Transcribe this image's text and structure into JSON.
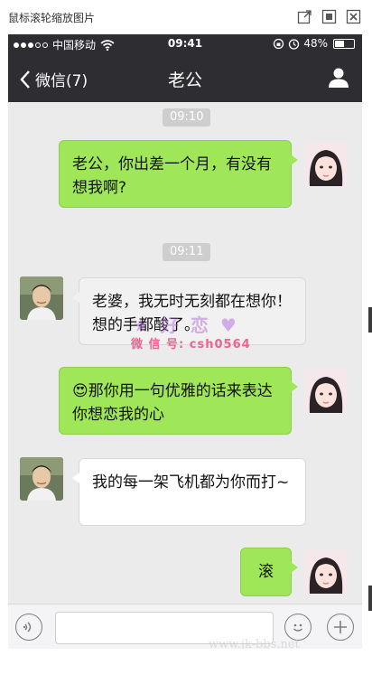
{
  "viewer": {
    "title": "鼠标滚轮缩放图片"
  },
  "status": {
    "carrier": "中国移动",
    "time": "09:41",
    "battery": "48%",
    "battery_level": 0.48
  },
  "nav": {
    "back_label": "微信(7)",
    "title": "老公"
  },
  "messages": [
    {
      "type": "time",
      "text": "09:10"
    },
    {
      "type": "me",
      "text": "老公，你出差一个月，有没有想我啊?"
    },
    {
      "type": "time",
      "text": "09:11"
    },
    {
      "type": "them",
      "text": "老婆，我无时无刻都在想你！想的手都酸了。"
    },
    {
      "type": "me",
      "emoji": "😍",
      "text": "那你用一句优雅的话来表达你想恋我的心"
    },
    {
      "type": "them",
      "text": "我的每一架飞机都为你而打~"
    },
    {
      "type": "me",
      "text": "滚"
    }
  ],
  "watermark": {
    "decor": "★ 好 恋 ♥",
    "line": "微 信 号: csh0564"
  },
  "input": {
    "value": ""
  },
  "bottom_watermark": {
    "logo": "",
    "url": "www.jk-bbs.net"
  }
}
